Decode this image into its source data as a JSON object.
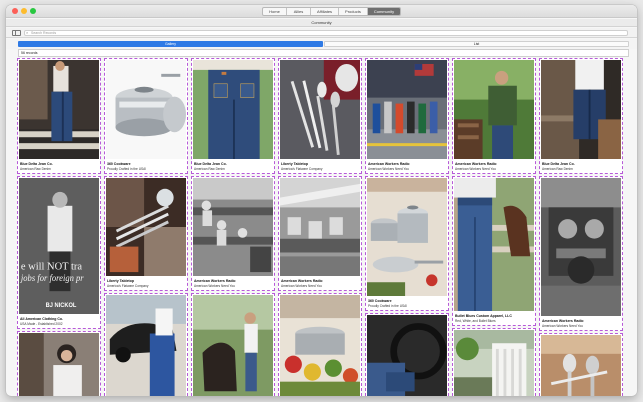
{
  "window": {
    "title": "Community",
    "tabs": [
      {
        "label": "Home",
        "active": false
      },
      {
        "label": "Allies",
        "active": false
      },
      {
        "label": "Affiliates",
        "active": false
      },
      {
        "label": "Products",
        "active": false
      },
      {
        "label": "Community",
        "active": true
      }
    ]
  },
  "toolbar": {
    "search_placeholder": "Search Records",
    "sidebar_icon": "sidebar-icon"
  },
  "layout": {
    "left_label": "Gallery",
    "right_label": "List"
  },
  "records_count": "56 records",
  "accent_color": "#2f7ae5",
  "cards": [
    {
      "brand": "Blue Delta Jean Co.",
      "tagline": "American Raw Denim",
      "icon": "denim-photo"
    },
    {
      "brand": "360 Cookware",
      "tagline": "Proudly Crafted in the USA!",
      "icon": "cookware-photo"
    },
    {
      "brand": "Blue Delta Jean Co.",
      "tagline": "American Raw Denim",
      "icon": "jeans-back-photo"
    },
    {
      "brand": "Liberty Tabletop",
      "tagline": "America's Flatware Company",
      "icon": "flatware-photo"
    },
    {
      "brand": "American Workers Radio",
      "tagline": "American Workers Need You",
      "icon": "workers-photo"
    },
    {
      "brand": "American Workers Radio",
      "tagline": "American Workers Need You",
      "icon": "jacket-man-photo"
    },
    {
      "brand": "Blue Delta Jean Co.",
      "tagline": "American Raw Denim",
      "icon": "denim-bar-photo"
    },
    {
      "brand": "All American Clothing Co.",
      "tagline": "USA Made - Established 2002",
      "icon": "poster-man-photo"
    },
    {
      "brand": "Liberty Tabletop",
      "tagline": "America's Flatware Company",
      "icon": "forks-photo"
    },
    {
      "brand": "American Workers Radio",
      "tagline": "American Workers Need You",
      "icon": "factory-photo"
    },
    {
      "brand": "American Workers Radio",
      "tagline": "American Workers Need You",
      "icon": "assembly-photo"
    },
    {
      "brand": "All American Clothing Co.",
      "tagline": "USA Made - Established 2002",
      "icon": "pots-photo"
    },
    {
      "brand": "Bullet Blues Custom Apparel, LLC",
      "tagline": "Red, White, and Bullet Blues",
      "icon": "jeans-horse-photo"
    },
    {
      "brand": "American Workers Radio",
      "tagline": "American Workers Need You",
      "icon": "engine-photo"
    },
    {
      "brand": "360 Cookware",
      "tagline": "Proudly Crafted in the USA!",
      "icon": "pan-photo"
    }
  ],
  "poster_text": {
    "line1": "e will NOT tra",
    "line2": "jobs for foreign pr",
    "name": "BJ NICKOL"
  }
}
